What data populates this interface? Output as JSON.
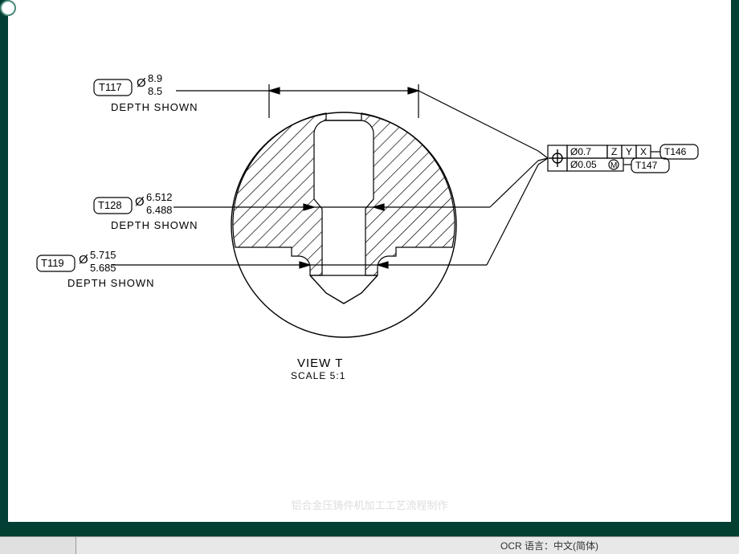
{
  "callouts": {
    "t117": {
      "tag": "T117",
      "dia_u": "8.9",
      "dia_l": "8.5",
      "depth": "DEPTH SHOWN"
    },
    "t128": {
      "tag": "T128",
      "dia_u": "6.512",
      "dia_l": "6.488",
      "depth": "DEPTH SHOWN"
    },
    "t119": {
      "tag": "T119",
      "dia_u": "5.715",
      "dia_l": "5.685",
      "depth": "DEPTH SHOWN"
    }
  },
  "fcf": {
    "row1": {
      "tol": "Ø0.7",
      "datums": [
        "Z",
        "Y",
        "X"
      ],
      "tag": "T146"
    },
    "row2": {
      "tol": "Ø0.05",
      "mod": "M",
      "tag": "T147"
    }
  },
  "view": {
    "name": "VIEW  T",
    "scale": "SCALE 5:1"
  },
  "status": {
    "lang": "OCR 语言：中文(简体)"
  },
  "watermark": "铝合金压铸件机加工工艺流程制作"
}
